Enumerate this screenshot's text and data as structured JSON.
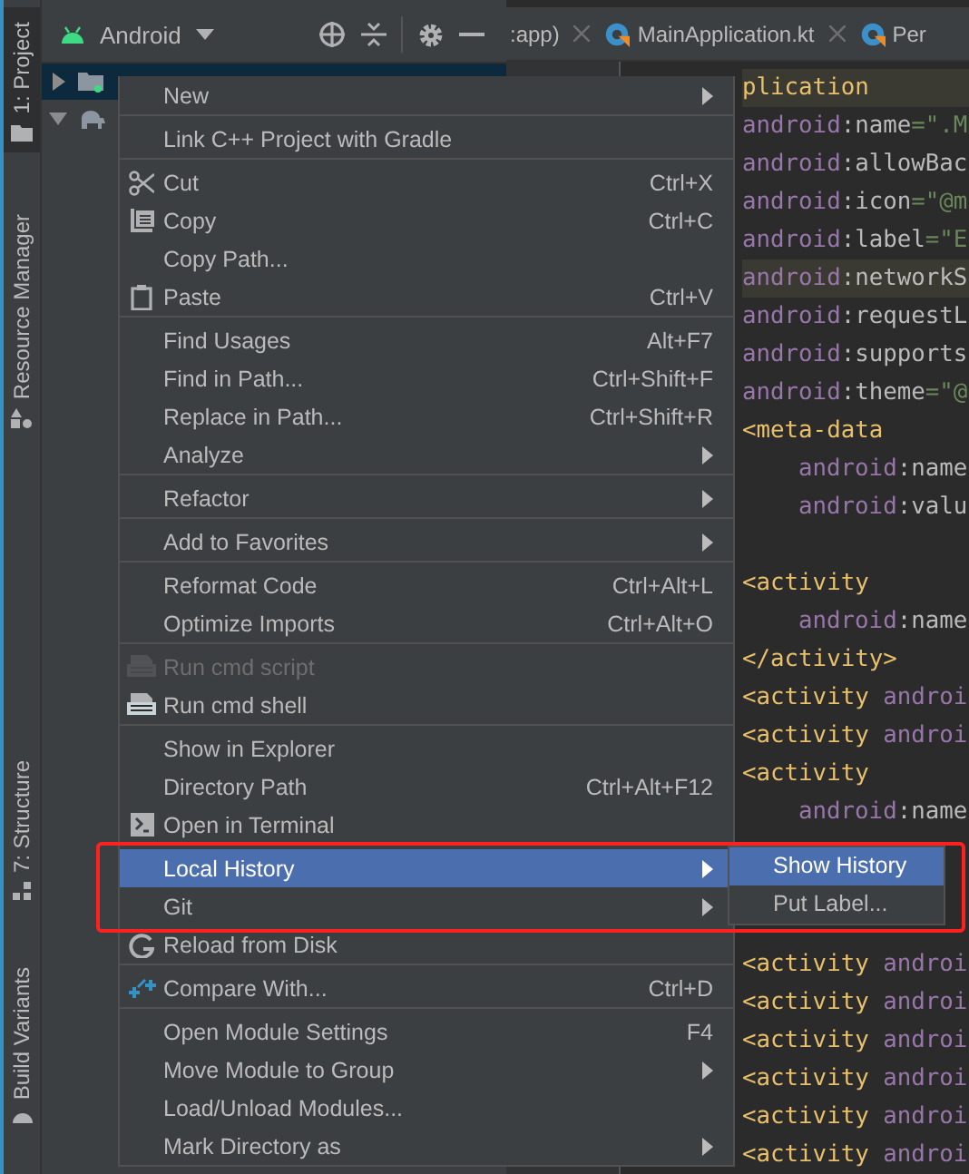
{
  "tool_strip": [
    {
      "label": "1: Project",
      "selected": true
    },
    {
      "label": "Resource Manager",
      "selected": false
    },
    {
      "label": "7: Structure",
      "selected": false
    },
    {
      "label": "Build Variants",
      "selected": false
    }
  ],
  "project_panel": {
    "view": "Android",
    "tree": [
      {
        "kind": "folder",
        "selected": true,
        "expanded": false
      },
      {
        "kind": "gradle",
        "selected": false,
        "expanded": true
      }
    ]
  },
  "editor_tabs": [
    {
      "label": ":app)"
    },
    {
      "label": "MainApplication.kt"
    },
    {
      "label": "Per"
    }
  ],
  "code_lines": [
    {
      "kind": "code",
      "highlighted": true,
      "segments": [
        {
          "kind": "tag",
          "text": "plication"
        }
      ]
    },
    {
      "kind": "code",
      "highlighted": false,
      "segments": [
        {
          "kind": "ns",
          "text": "android"
        },
        {
          "kind": "attr",
          "text": ":name"
        },
        {
          "kind": "value",
          "text": "=\".M"
        }
      ]
    },
    {
      "kind": "code",
      "highlighted": false,
      "segments": [
        {
          "kind": "ns",
          "text": "android"
        },
        {
          "kind": "attr",
          "text": ":allowBac"
        }
      ]
    },
    {
      "kind": "code",
      "highlighted": false,
      "segments": [
        {
          "kind": "ns",
          "text": "android"
        },
        {
          "kind": "attr",
          "text": ":icon"
        },
        {
          "kind": "value",
          "text": "=\"@m"
        }
      ]
    },
    {
      "kind": "code",
      "highlighted": false,
      "segments": [
        {
          "kind": "ns",
          "text": "android"
        },
        {
          "kind": "attr",
          "text": ":label"
        },
        {
          "kind": "value",
          "text": "=\"E"
        }
      ]
    },
    {
      "kind": "code",
      "highlighted": true,
      "segments": [
        {
          "kind": "ns",
          "text": "android"
        },
        {
          "kind": "attr",
          "text": ":networkS"
        }
      ]
    },
    {
      "kind": "code",
      "highlighted": false,
      "segments": [
        {
          "kind": "ns",
          "text": "android"
        },
        {
          "kind": "attr",
          "text": ":requestL"
        }
      ]
    },
    {
      "kind": "code",
      "highlighted": false,
      "segments": [
        {
          "kind": "ns",
          "text": "android"
        },
        {
          "kind": "attr",
          "text": ":supports"
        }
      ]
    },
    {
      "kind": "code",
      "highlighted": false,
      "segments": [
        {
          "kind": "ns",
          "text": "android"
        },
        {
          "kind": "attr",
          "text": ":theme"
        },
        {
          "kind": "value",
          "text": "=\"@"
        }
      ]
    },
    {
      "kind": "code",
      "highlighted": false,
      "segments": [
        {
          "kind": "tag",
          "text": "<meta-data"
        }
      ]
    },
    {
      "kind": "nested",
      "highlighted": false,
      "segments": [
        {
          "kind": "ns",
          "text": "android"
        },
        {
          "kind": "attr",
          "text": ":name"
        }
      ]
    },
    {
      "kind": "nested",
      "highlighted": false,
      "segments": [
        {
          "kind": "ns",
          "text": "android"
        },
        {
          "kind": "attr",
          "text": ":valu"
        }
      ]
    },
    {
      "kind": "blank"
    },
    {
      "kind": "code",
      "highlighted": false,
      "segments": [
        {
          "kind": "tag",
          "text": "<activity"
        }
      ]
    },
    {
      "kind": "nested",
      "highlighted": false,
      "segments": [
        {
          "kind": "ns",
          "text": "android"
        },
        {
          "kind": "attr",
          "text": ":name"
        }
      ]
    },
    {
      "kind": "code",
      "highlighted": false,
      "segments": [
        {
          "kind": "tag",
          "text": "</activity>"
        }
      ]
    },
    {
      "kind": "code",
      "highlighted": false,
      "segments": [
        {
          "kind": "tag",
          "text": "<activity "
        },
        {
          "kind": "ns",
          "text": "androi"
        }
      ]
    },
    {
      "kind": "code",
      "highlighted": false,
      "segments": [
        {
          "kind": "tag",
          "text": "<activity "
        },
        {
          "kind": "ns",
          "text": "androi"
        }
      ]
    },
    {
      "kind": "code",
      "highlighted": false,
      "segments": [
        {
          "kind": "tag",
          "text": "<activity"
        }
      ]
    },
    {
      "kind": "nested",
      "highlighted": false,
      "segments": [
        {
          "kind": "ns",
          "text": "android"
        },
        {
          "kind": "attr",
          "text": ":name"
        }
      ]
    },
    {
      "kind": "blank"
    },
    {
      "kind": "blank"
    },
    {
      "kind": "blank"
    },
    {
      "kind": "code",
      "highlighted": false,
      "segments": [
        {
          "kind": "tag",
          "text": "<activity "
        },
        {
          "kind": "ns",
          "text": "androi"
        }
      ]
    },
    {
      "kind": "code",
      "highlighted": false,
      "segments": [
        {
          "kind": "tag",
          "text": "<activity "
        },
        {
          "kind": "ns",
          "text": "androi"
        }
      ]
    },
    {
      "kind": "code",
      "highlighted": false,
      "segments": [
        {
          "kind": "tag",
          "text": "<activity "
        },
        {
          "kind": "ns",
          "text": "androi"
        }
      ]
    },
    {
      "kind": "code",
      "highlighted": false,
      "segments": [
        {
          "kind": "tag",
          "text": "<activity "
        },
        {
          "kind": "ns",
          "text": "androi"
        }
      ]
    },
    {
      "kind": "code",
      "highlighted": false,
      "segments": [
        {
          "kind": "tag",
          "text": "<activity "
        },
        {
          "kind": "ns",
          "text": "androi"
        }
      ]
    },
    {
      "kind": "code",
      "highlighted": false,
      "segments": [
        {
          "kind": "tag",
          "text": "<activity "
        },
        {
          "kind": "ns",
          "text": "androi"
        }
      ]
    }
  ],
  "context_menu": {
    "items": [
      {
        "label": "New",
        "submenu": true,
        "selected": false,
        "disabled": false,
        "separator_after": true
      },
      {
        "label": "Link C++ Project with Gradle",
        "submenu": false,
        "selected": false,
        "disabled": false,
        "separator_after": true
      },
      {
        "label": "Cut",
        "shortcut": "Ctrl+X",
        "submenu": false,
        "selected": false,
        "disabled": false,
        "separator_after": false
      },
      {
        "label": "Copy",
        "shortcut": "Ctrl+C",
        "submenu": false,
        "selected": false,
        "disabled": false,
        "separator_after": false
      },
      {
        "label": "Copy Path...",
        "submenu": false,
        "selected": false,
        "disabled": false,
        "separator_after": false
      },
      {
        "label": "Paste",
        "shortcut": "Ctrl+V",
        "submenu": false,
        "selected": false,
        "disabled": false,
        "separator_after": true
      },
      {
        "label": "Find Usages",
        "shortcut": "Alt+F7",
        "submenu": false,
        "selected": false,
        "disabled": false,
        "separator_after": false
      },
      {
        "label": "Find in Path...",
        "shortcut": "Ctrl+Shift+F",
        "submenu": false,
        "selected": false,
        "disabled": false,
        "separator_after": false
      },
      {
        "label": "Replace in Path...",
        "shortcut": "Ctrl+Shift+R",
        "submenu": false,
        "selected": false,
        "disabled": false,
        "separator_after": false
      },
      {
        "label": "Analyze",
        "submenu": true,
        "selected": false,
        "disabled": false,
        "separator_after": true
      },
      {
        "label": "Refactor",
        "submenu": true,
        "selected": false,
        "disabled": false,
        "separator_after": true
      },
      {
        "label": "Add to Favorites",
        "submenu": true,
        "selected": false,
        "disabled": false,
        "separator_after": true
      },
      {
        "label": "Reformat Code",
        "shortcut": "Ctrl+Alt+L",
        "submenu": false,
        "selected": false,
        "disabled": false,
        "separator_after": false
      },
      {
        "label": "Optimize Imports",
        "shortcut": "Ctrl+Alt+O",
        "submenu": false,
        "selected": false,
        "disabled": false,
        "separator_after": true
      },
      {
        "label": "Run cmd script",
        "submenu": false,
        "selected": false,
        "disabled": true,
        "separator_after": false
      },
      {
        "label": "Run cmd shell",
        "submenu": false,
        "selected": false,
        "disabled": false,
        "separator_after": true
      },
      {
        "label": "Show in Explorer",
        "submenu": false,
        "selected": false,
        "disabled": false,
        "separator_after": false
      },
      {
        "label": "Directory Path",
        "shortcut": "Ctrl+Alt+F12",
        "submenu": false,
        "selected": false,
        "disabled": false,
        "separator_after": false
      },
      {
        "label": "Open in Terminal",
        "submenu": false,
        "selected": false,
        "disabled": false,
        "separator_after": true
      },
      {
        "label": "Local History",
        "submenu": true,
        "selected": true,
        "disabled": false,
        "separator_after": false
      },
      {
        "label": "Git",
        "submenu": true,
        "selected": false,
        "disabled": false,
        "separator_after": false
      },
      {
        "label": "Reload from Disk",
        "submenu": false,
        "selected": false,
        "disabled": false,
        "separator_after": true
      },
      {
        "label": "Compare With...",
        "shortcut": "Ctrl+D",
        "submenu": false,
        "selected": false,
        "disabled": false,
        "separator_after": true
      },
      {
        "label": "Open Module Settings",
        "shortcut": "F4",
        "submenu": false,
        "selected": false,
        "disabled": false,
        "separator_after": false
      },
      {
        "label": "Move Module to Group",
        "submenu": true,
        "selected": false,
        "disabled": false,
        "separator_after": false
      },
      {
        "label": "Load/Unload Modules...",
        "submenu": false,
        "selected": false,
        "disabled": false,
        "separator_after": false
      },
      {
        "label": "Mark Directory as",
        "submenu": true,
        "selected": false,
        "disabled": false,
        "separator_after": false
      }
    ]
  },
  "submenu": {
    "items": [
      {
        "label": "Show History",
        "selected": true
      },
      {
        "label": "Put Label...",
        "selected": false
      }
    ]
  },
  "annotation_frame": {
    "shown": true
  }
}
